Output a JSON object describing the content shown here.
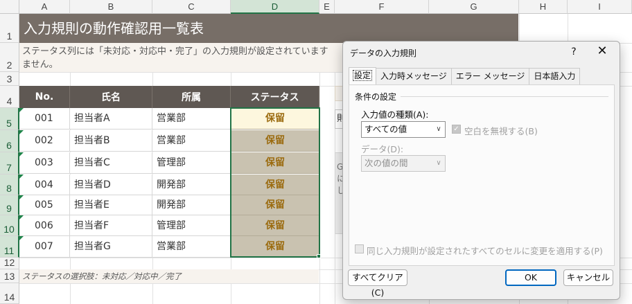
{
  "columns": [
    "A",
    "B",
    "C",
    "D",
    "E",
    "F",
    "G",
    "H",
    "I"
  ],
  "rows": [
    "1",
    "2",
    "3",
    "4",
    "5",
    "6",
    "7",
    "8",
    "9",
    "10",
    "11",
    "12",
    "13",
    "14"
  ],
  "sheet": {
    "title": "入力規則の動作確認用一覧表",
    "description": "ステータス列には「未対応・対応中・完了」の入力規則が設定されています。ません。",
    "description_line1": "ステータス列には「未対応・対応中・完了」の入力規則が設定されています",
    "description_line2": "ません。",
    "table": {
      "headers": [
        "No.",
        "氏名",
        "所属",
        "ステータス"
      ],
      "rows": [
        {
          "no": "001",
          "name": "担当者A",
          "dept": "営業部",
          "status": "保留"
        },
        {
          "no": "002",
          "name": "担当者B",
          "dept": "営業部",
          "status": "保留"
        },
        {
          "no": "003",
          "name": "担当者C",
          "dept": "管理部",
          "status": "保留"
        },
        {
          "no": "004",
          "name": "担当者D",
          "dept": "開発部",
          "status": "保留"
        },
        {
          "no": "005",
          "name": "担当者E",
          "dept": "開発部",
          "status": "保留"
        },
        {
          "no": "006",
          "name": "担当者F",
          "dept": "管理部",
          "status": "保留"
        },
        {
          "no": "007",
          "name": "担当者G",
          "dept": "営業部",
          "status": "保留"
        }
      ]
    },
    "note": "ステータスの選択肢：未対応／対応中／完了",
    "peek_f5": "則",
    "peek_g": "G",
    "peek_ni": "に",
    "peek_shi": "し"
  },
  "dialog": {
    "title": "データの入力規則",
    "help": "?",
    "close": "✕",
    "tabs": [
      "設定",
      "入力時メッセージ",
      "エラー メッセージ",
      "日本語入力"
    ],
    "group_label": "条件の設定",
    "allow_label": "入力値の種類(A):",
    "allow_value": "すべての値",
    "ignore_blank_label": "空白を無視する(B)",
    "data_label": "データ(D):",
    "data_value": "次の値の間",
    "apply_all_label": "同じ入力規則が設定されたすべてのセルに変更を適用する(P)",
    "clear_all": "すべてクリア(C)",
    "ok": "OK",
    "cancel": "キャンセル",
    "dropdown_glyph": "∨",
    "check_glyph": "✓"
  }
}
